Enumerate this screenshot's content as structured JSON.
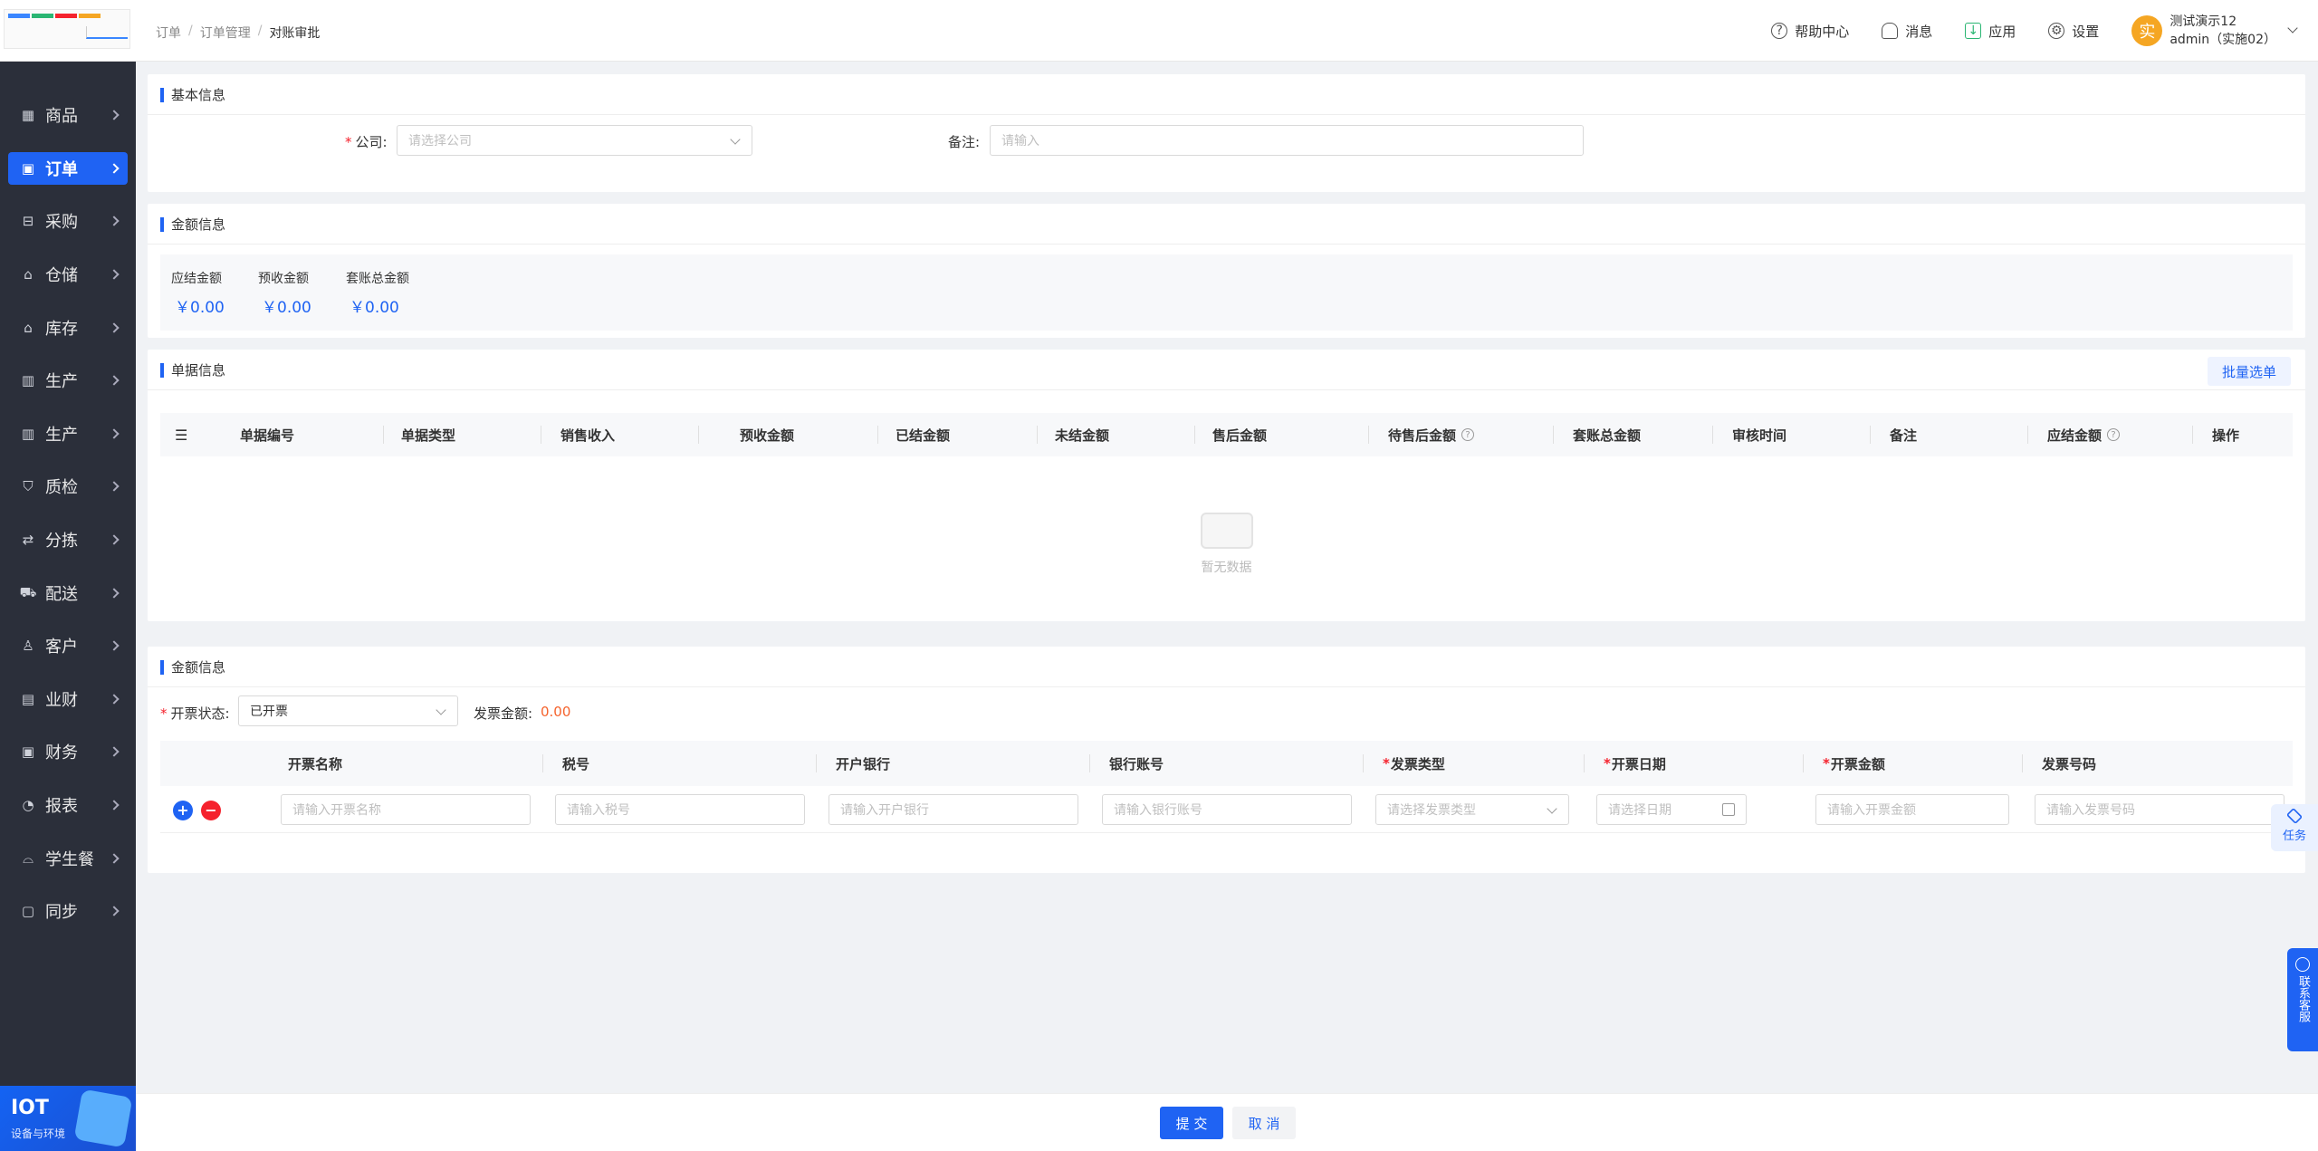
{
  "sidebar": {
    "items": [
      {
        "label": "商品",
        "icon": "grid-icon"
      },
      {
        "label": "订单",
        "icon": "clipboard-icon",
        "active": true
      },
      {
        "label": "采购",
        "icon": "basket-icon"
      },
      {
        "label": "仓储",
        "icon": "warehouse-icon"
      },
      {
        "label": "库存",
        "icon": "stock-icon"
      },
      {
        "label": "生产",
        "icon": "factory-icon"
      },
      {
        "label": "生产",
        "icon": "factory-icon"
      },
      {
        "label": "质检",
        "icon": "shield-icon"
      },
      {
        "label": "分拣",
        "icon": "sort-icon"
      },
      {
        "label": "配送",
        "icon": "truck-icon"
      },
      {
        "label": "客户",
        "icon": "user-icon"
      },
      {
        "label": "业财",
        "icon": "chart-icon"
      },
      {
        "label": "财务",
        "icon": "finance-icon"
      },
      {
        "label": "报表",
        "icon": "report-icon"
      },
      {
        "label": "学生餐",
        "icon": "meal-icon"
      },
      {
        "label": "同步",
        "icon": "sync-icon"
      }
    ],
    "iot": {
      "title": "IOT",
      "subtitle": "设备与环境"
    }
  },
  "header": {
    "breadcrumb": [
      "订单",
      "订单管理",
      "对账审批"
    ],
    "help": "帮助中心",
    "messages": "消息",
    "apps": "应用",
    "settings": "设置",
    "user": {
      "avatar": "实",
      "name": "测试演示12",
      "account": "admin（实施02）"
    }
  },
  "basic": {
    "title": "基本信息",
    "company_label": "公司:",
    "company_placeholder": "请选择公司",
    "remark_label": "备注:",
    "remark_placeholder": "请输入"
  },
  "amount": {
    "title": "金额信息",
    "items": [
      {
        "label": "应结金额",
        "value": "￥0.00"
      },
      {
        "label": "预收金额",
        "value": "￥0.00"
      },
      {
        "label": "套账总金额",
        "value": "￥0.00"
      }
    ]
  },
  "docs": {
    "title": "单据信息",
    "batch_button": "批量选单",
    "columns": [
      "单据编号",
      "单据类型",
      "销售收入",
      "预收金额",
      "已结金额",
      "未结金额",
      "售后金额",
      "待售后金额",
      "套账总金额",
      "审核时间",
      "备注",
      "应结金额",
      "操作"
    ],
    "empty_text": "暂无数据"
  },
  "invoice": {
    "title": "金额信息",
    "status_label": "开票状态:",
    "status_value": "已开票",
    "amount_label": "发票金额:",
    "amount_value": "0.00",
    "columns": [
      "开票名称",
      "税号",
      "开户银行",
      "银行账号",
      "发票类型",
      "开票日期",
      "开票金额",
      "发票号码"
    ],
    "placeholders": [
      "请输入开票名称",
      "请输入税号",
      "请输入开户银行",
      "请输入银行账号",
      "请选择发票类型",
      "请选择日期",
      "请输入开票金额",
      "请输入发票号码"
    ]
  },
  "footer": {
    "submit": "提 交",
    "cancel": "取 消"
  },
  "floating": {
    "task": "任务",
    "service": "联系客服"
  },
  "colors": {
    "primary": "#1f63f3",
    "sidebar": "#2b2f3a",
    "danger": "#f5222d",
    "avatar": "#f5a623"
  }
}
